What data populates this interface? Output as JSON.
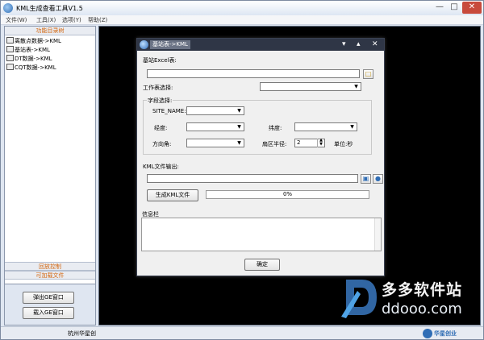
{
  "window": {
    "title": "KML生成查看工具V1.5"
  },
  "menu": [
    "文件(W)",
    "工具(X)",
    "选项(Y)",
    "帮助(Z)"
  ],
  "left_panel": {
    "header": "功能目录树",
    "tree_items": [
      "离散点数据->KML",
      "基站表->KML",
      "DT数据->KML",
      "CQT数据->KML"
    ],
    "bars": [
      "回放控制",
      "可加载文件"
    ],
    "buttons": [
      "弹出GE窗口",
      "载入GE窗口"
    ]
  },
  "dialog": {
    "title": "基站表->KML",
    "excel_label": "基站Excel表:",
    "excel_value": "",
    "sheet_label": "工作表选择:",
    "sheet_value": "",
    "group_title": "字段选择:",
    "site_name_label": "SITE_NAME:",
    "longitude_label": "经度:",
    "latitude_label": "纬度:",
    "azimuth_label": "方向角:",
    "radius_label": "扇区半径:",
    "radius_value": "2",
    "unit_label": "单位:秒",
    "kml_output_label": "KML文件输出:",
    "kml_output_value": "",
    "generate_button": "生成KML文件",
    "progress": "0%",
    "progress_value": 0,
    "info_label": "信息栏",
    "info_text": "",
    "ok_button": "确定"
  },
  "statusbar": {
    "left_text": "杭州华星创",
    "brand": "华星创业"
  },
  "watermark": {
    "cn": "多多软件站",
    "en": "ddooo.com"
  },
  "colors": {
    "accent_orange": "#d3660f",
    "dialog_titlebar": "#2f3646",
    "map_background": "#000000"
  }
}
